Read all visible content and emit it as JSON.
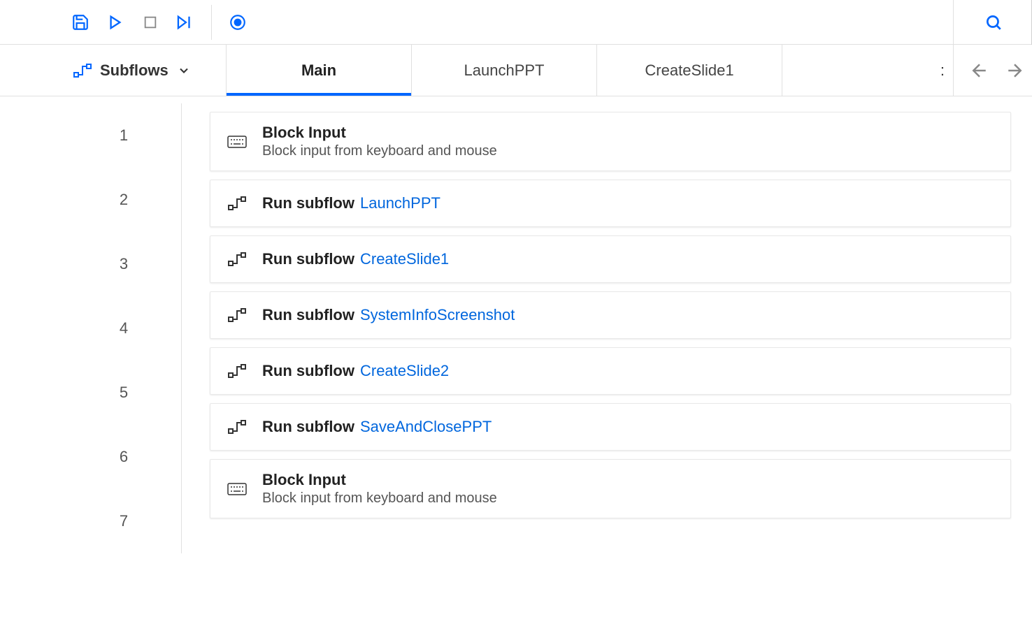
{
  "toolbar": {
    "icons": {
      "save": "save-icon",
      "run": "run-icon",
      "stop": "stop-icon",
      "step": "step-icon",
      "record": "record-icon",
      "search": "search-icon"
    }
  },
  "subflows": {
    "label": "Subflows"
  },
  "tabs": [
    {
      "label": "Main",
      "active": true
    },
    {
      "label": "LaunchPPT",
      "active": false
    },
    {
      "label": "CreateSlide1",
      "active": false
    }
  ],
  "overflow_hint": ":",
  "actions": [
    {
      "line": "1",
      "icon": "keyboard",
      "title": "Block Input",
      "param": "",
      "desc": "Block input from keyboard and mouse"
    },
    {
      "line": "2",
      "icon": "subflow",
      "title": "Run subflow",
      "param": "LaunchPPT",
      "desc": ""
    },
    {
      "line": "3",
      "icon": "subflow",
      "title": "Run subflow",
      "param": "CreateSlide1",
      "desc": ""
    },
    {
      "line": "4",
      "icon": "subflow",
      "title": "Run subflow",
      "param": "SystemInfoScreenshot",
      "desc": ""
    },
    {
      "line": "5",
      "icon": "subflow",
      "title": "Run subflow",
      "param": "CreateSlide2",
      "desc": ""
    },
    {
      "line": "6",
      "icon": "subflow",
      "title": "Run subflow",
      "param": "SaveAndClosePPT",
      "desc": ""
    },
    {
      "line": "7",
      "icon": "keyboard",
      "title": "Block Input",
      "param": "",
      "desc": "Block input from keyboard and mouse"
    }
  ]
}
